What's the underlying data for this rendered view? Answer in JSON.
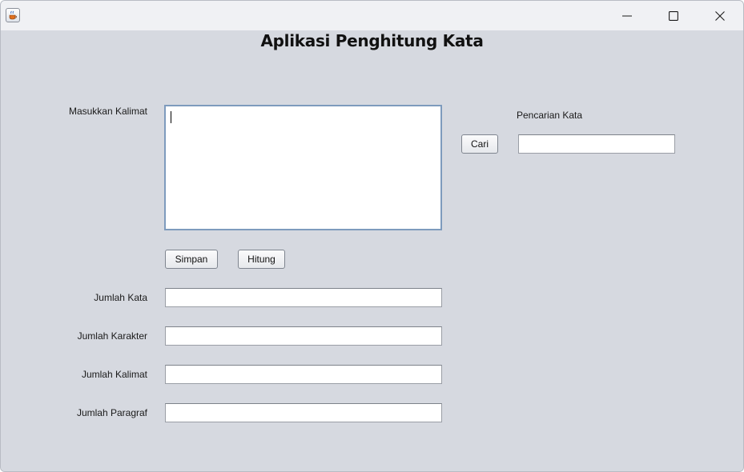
{
  "window": {
    "app_icon": "java-cup-icon",
    "controls": {
      "minimize_icon": "minimize-icon",
      "maximize_icon": "maximize-icon",
      "close_icon": "close-icon"
    }
  },
  "main": {
    "title": "Aplikasi Penghitung Kata",
    "input_label": "Masukkan Kalimat",
    "input_value": "",
    "buttons": {
      "save": "Simpan",
      "count": "Hitung",
      "search": "Cari"
    },
    "search": {
      "label": "Pencarian Kata",
      "value": ""
    },
    "results": [
      {
        "label": "Jumlah Kata",
        "value": ""
      },
      {
        "label": "Jumlah Karakter",
        "value": ""
      },
      {
        "label": "Jumlah Kalimat",
        "value": ""
      },
      {
        "label": "Jumlah Paragraf",
        "value": ""
      }
    ]
  },
  "colors": {
    "background": "#d6d9e0",
    "titlebar": "#f0f1f4",
    "textarea_focus_border": "#7e9bbd"
  }
}
